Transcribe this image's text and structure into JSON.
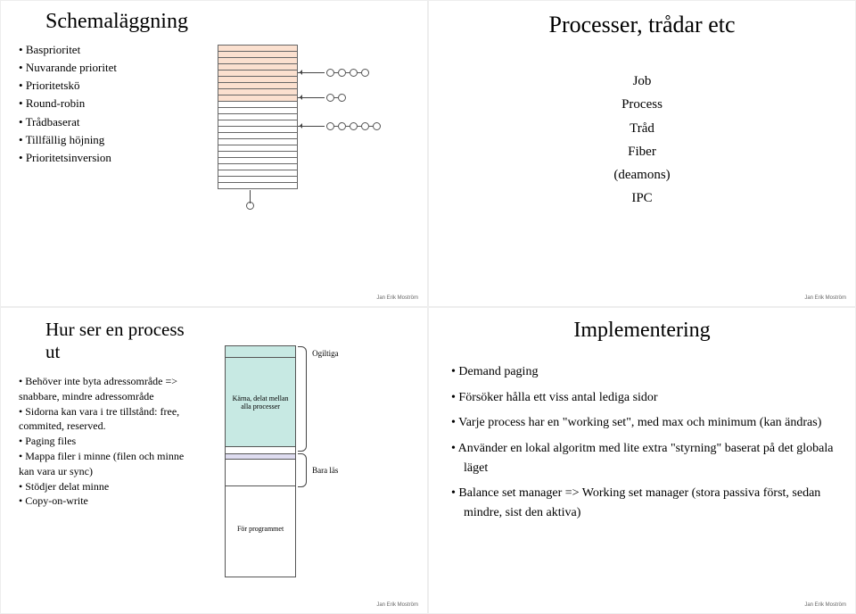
{
  "footer": "Jan Erik Moström",
  "slide1": {
    "title": "Schemaläggning",
    "bullets": [
      "Basprioritet",
      "Nuvarande prioritet",
      "Prioritetskö",
      "Round-robin",
      "Trådbaserat",
      "Tillfällig höjning",
      "Prioritetsinversion"
    ]
  },
  "slide2": {
    "title": "Processer, trådar etc",
    "items": [
      "Job",
      "Process",
      "Tråd",
      "Fiber",
      "(deamons)",
      "IPC"
    ]
  },
  "slide3": {
    "title": "Hur ser en process ut",
    "bullets": [
      "Behöver inte byta adressområde => snabbare, mindre adressområde",
      "Sidorna kan vara i tre tillstånd: free, commited, reserved.",
      "Paging files",
      "Mappa filer i minne (filen och minne kan vara ur sync)",
      "Stödjer delat minne",
      "Copy-on-write"
    ],
    "mem": {
      "kernel": "Kärna, delat mellan alla processer",
      "program": "För programmet",
      "brace1": "Ogiltiga",
      "brace2": "Bara läs"
    }
  },
  "slide4": {
    "title": "Implementering",
    "bullets": [
      "Demand paging",
      "Försöker hålla ett viss antal lediga sidor",
      "Varje process har en \"working set\", med max och minimum (kan ändras)",
      "Använder en lokal algoritm med lite extra \"styrning\" baserat på det globala läget",
      "Balance set manager => Working set manager (stora passiva först, sedan mindre, sist den aktiva)"
    ]
  }
}
